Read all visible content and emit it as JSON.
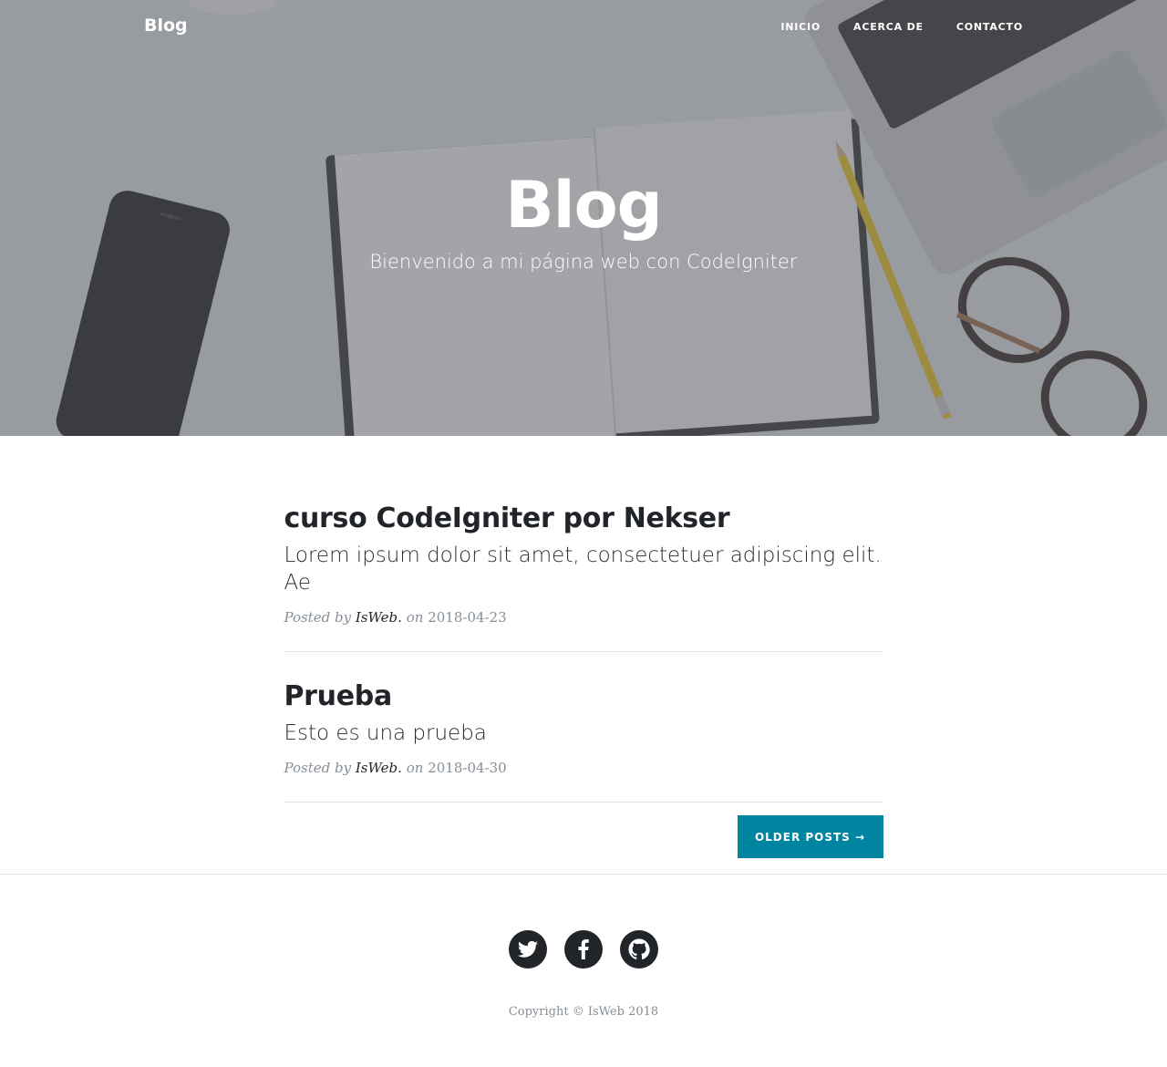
{
  "nav": {
    "brand": "Blog",
    "links": [
      "INICIO",
      "ACERCA DE",
      "CONTACTO"
    ]
  },
  "hero": {
    "title": "Blog",
    "subtitle": "Bienvenido a mi página web con CodeIgniter"
  },
  "posts": [
    {
      "title": "curso CodeIgniter por Nekser",
      "subtitle": "Lorem ipsum dolor sit amet, consectetuer adipiscing elit. Ae",
      "meta_prefix": "Posted by",
      "author": "IsWeb.",
      "meta_on": "on",
      "date": "2018-04-23"
    },
    {
      "title": "Prueba",
      "subtitle": "Esto es una prueba",
      "meta_prefix": "Posted by",
      "author": "IsWeb.",
      "meta_on": "on",
      "date": "2018-04-30"
    }
  ],
  "pager": {
    "older_label": "OLDER POSTS →"
  },
  "footer": {
    "social": [
      "twitter-icon",
      "facebook-icon",
      "github-icon"
    ],
    "copyright": "Copyright © IsWeb 2018"
  },
  "colors": {
    "accent": "#0085a1",
    "dark": "#212529",
    "muted": "#868e96"
  }
}
